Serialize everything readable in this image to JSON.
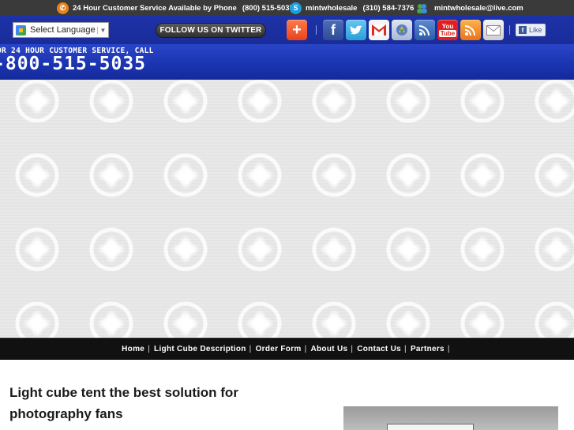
{
  "topbar": {
    "service_text": "24 Hour Customer Service Available by Phone",
    "service_phone": "(800) 515-5035",
    "skype_name": "mintwholesale",
    "skype_phone": "(310) 584-7376",
    "msn_email": "mintwholesale@live.com"
  },
  "socialbar": {
    "language_label": "Select Language",
    "twitter_label": "FOLLOW US ON TWITTER",
    "fb_like": "Like",
    "icons": [
      "add-this-icon",
      "facebook-icon",
      "twitter-icon",
      "gmail-icon",
      "google-reader-icon",
      "rss-icon",
      "youtube-icon",
      "rss-feed-icon",
      "email-icon"
    ]
  },
  "header": {
    "line1": "OR 24 HOUR CUSTOMER SERVICE, CALL",
    "line2": "-800-515-5035"
  },
  "nav": {
    "items": [
      {
        "label": "Home"
      },
      {
        "label": "Light Cube Description"
      },
      {
        "label": "Order Form"
      },
      {
        "label": "About Us"
      },
      {
        "label": "Contact Us"
      },
      {
        "label": "Partners"
      }
    ]
  },
  "main": {
    "title": "Light cube tent the best solution for photography fans"
  },
  "colors": {
    "brand_blue": "#1a33b0",
    "topbar": "#3a3a3a",
    "nav": "#111111"
  }
}
